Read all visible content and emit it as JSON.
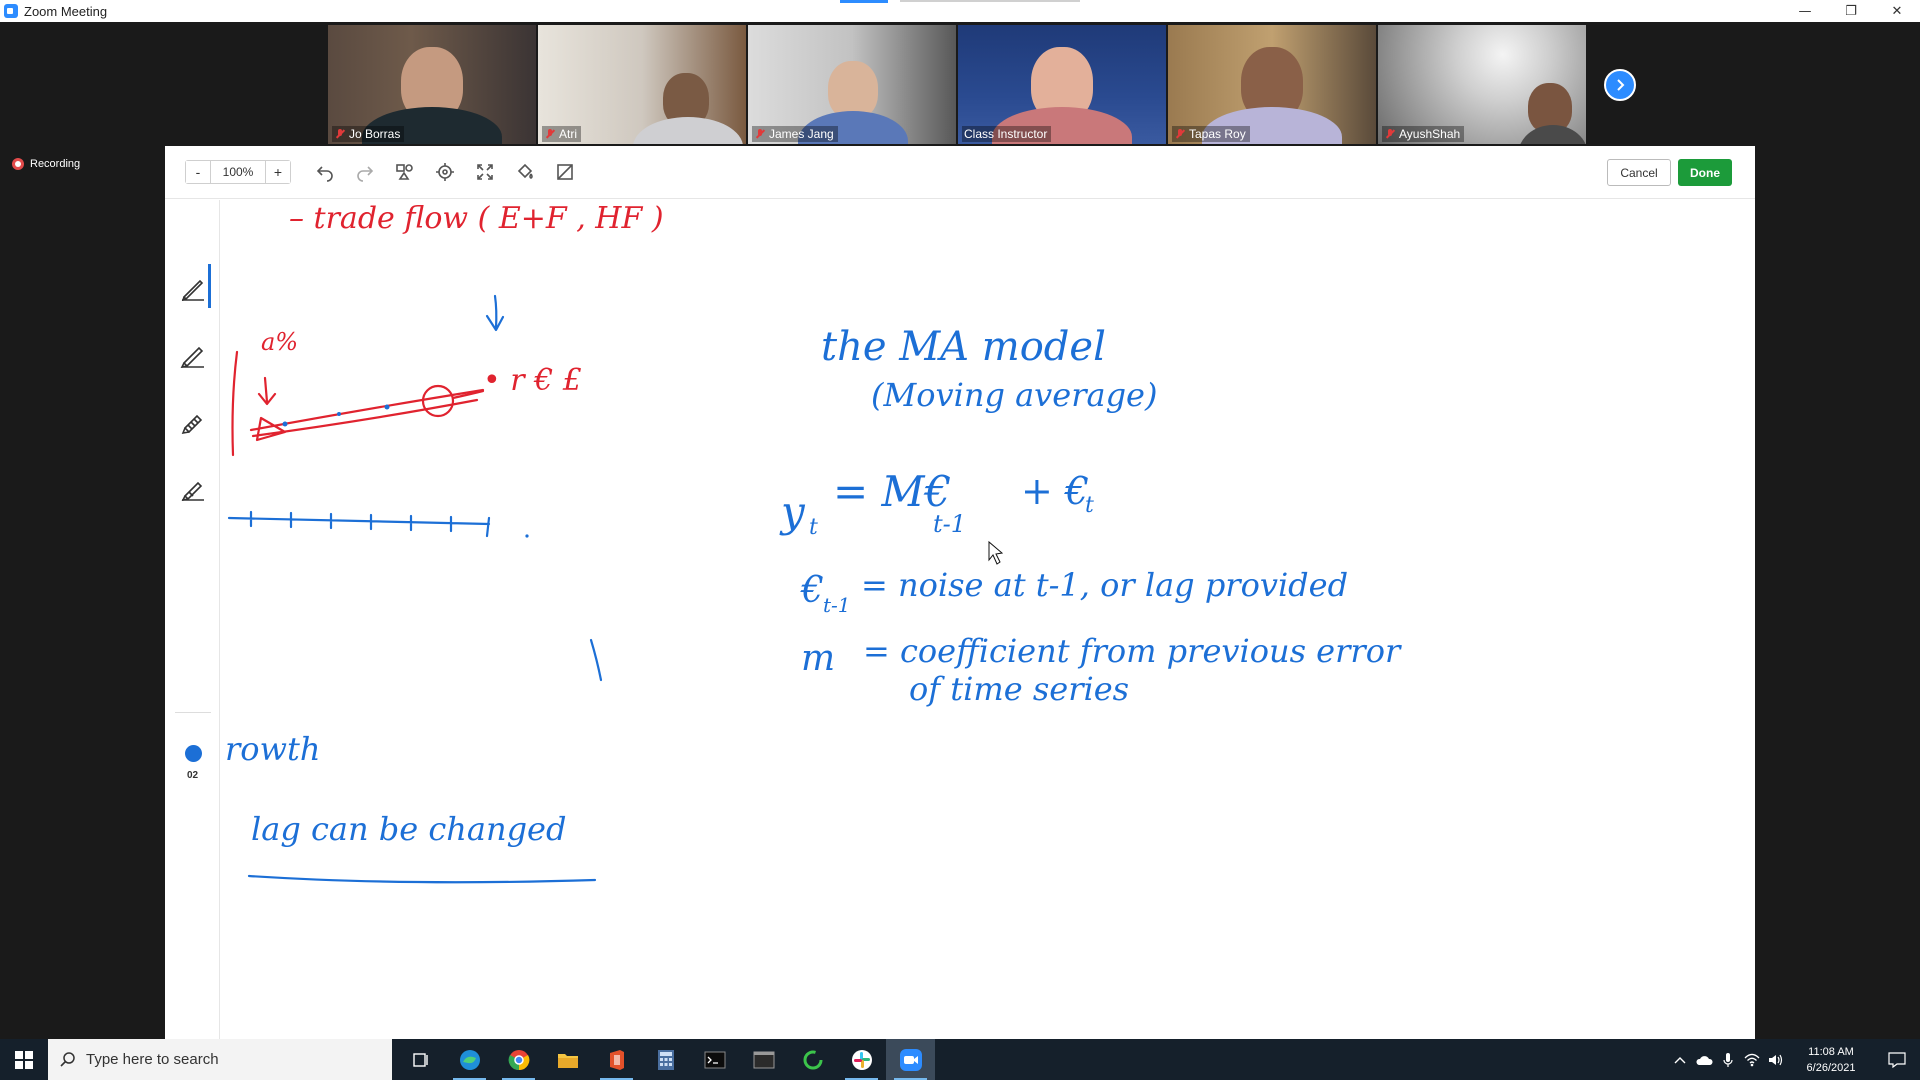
{
  "window": {
    "title": "Zoom Meeting",
    "controls": {
      "minimize": "—",
      "restore": "❐",
      "close": "✕"
    }
  },
  "participants": [
    {
      "name": "Jo Borras",
      "muted": true,
      "active": false
    },
    {
      "name": "Atri",
      "muted": true,
      "active": false
    },
    {
      "name": "James Jang",
      "muted": true,
      "active": false
    },
    {
      "name": "Class Instructor",
      "muted": false,
      "active": true
    },
    {
      "name": "Tapas Roy",
      "muted": true,
      "active": false
    },
    {
      "name": "AyushShah",
      "muted": true,
      "active": false
    }
  ],
  "recording": {
    "label": "Recording"
  },
  "toolbar": {
    "zoom_minus": "-",
    "zoom_value": "100%",
    "zoom_plus": "+",
    "cancel_label": "Cancel",
    "done_label": "Done"
  },
  "sidepanel": {
    "pen_size": "02",
    "color": "#1c6fd6"
  },
  "whiteboard": {
    "red_title": "– trade flow ( E+F , HF )",
    "red_note1": "a%",
    "red_note2": "• r € £",
    "blue_title_1": "the MA model",
    "blue_title_2": "(Moving average)",
    "eq_lhs": "y",
    "eq_lhs_sub": "t",
    "eq_eq": "= M€",
    "eq_sub1": "t-1",
    "eq_plus": "+ €",
    "eq_sub2": "t",
    "def1_sym": "€",
    "def1_sub": "t-1",
    "def1_text": "= noise at t-1, or lag provided",
    "def2_sym": "m",
    "def2_text": "= coefficient from previous error",
    "def2_text_2": "of time series",
    "left_note1": "rowth",
    "left_note2": "lag can be changed",
    "ink_red": "#e0232f",
    "ink_blue": "#1c6fd6"
  },
  "taskbar": {
    "search_placeholder": "Type here to search",
    "time": "11:08 AM",
    "date": "6/26/2021"
  }
}
